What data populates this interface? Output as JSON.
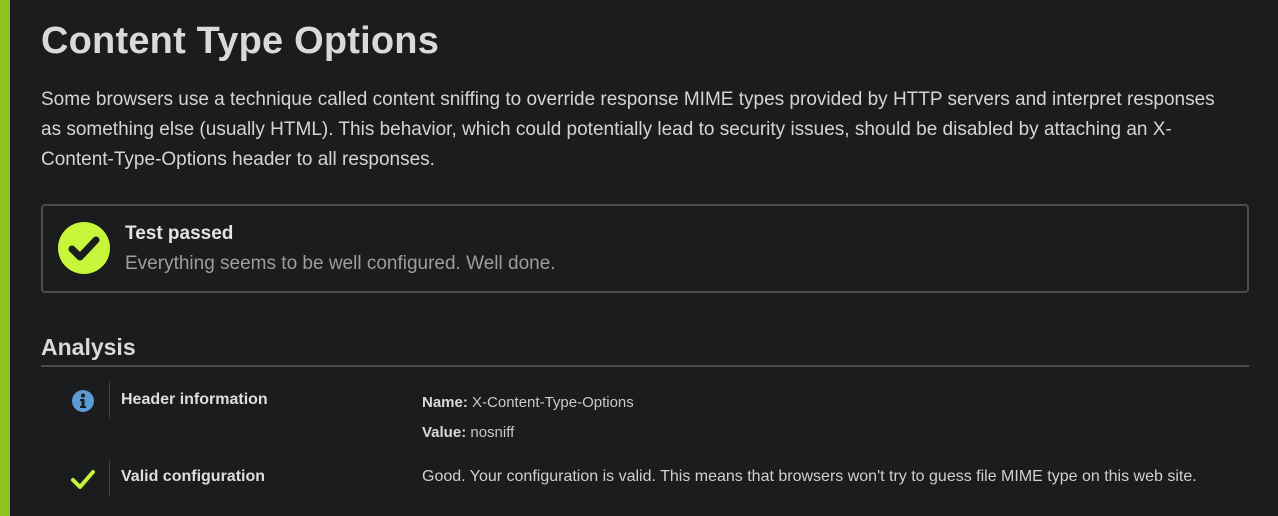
{
  "page": {
    "title": "Content Type Options",
    "intro": "Some browsers use a technique called content sniffing to override response MIME types provided by HTTP servers and interpret responses as something else (usually HTML). This behavior, which could potentially lead to security issues, should be disabled by attaching an X-Content-Type-Options header to all responses."
  },
  "result": {
    "icon": "check-circle-icon",
    "title": "Test passed",
    "message": "Everything seems to be well configured. Well done."
  },
  "analysis": {
    "title": "Analysis",
    "rows": [
      {
        "icon": "info-icon",
        "label": "Header information",
        "name_key": "Name:",
        "name_value": "X-Content-Type-Options",
        "value_key": "Value:",
        "value_value": "nosniff"
      },
      {
        "icon": "check-icon",
        "label": "Valid configuration",
        "text": "Good. Your configuration is valid. This means that browsers won't try to guess file MIME type on this web site."
      }
    ]
  },
  "colors": {
    "accent": "#8fc31f",
    "pass": "#c6f53a",
    "info": "#5b9bd5",
    "background": "#1b1c1e"
  }
}
